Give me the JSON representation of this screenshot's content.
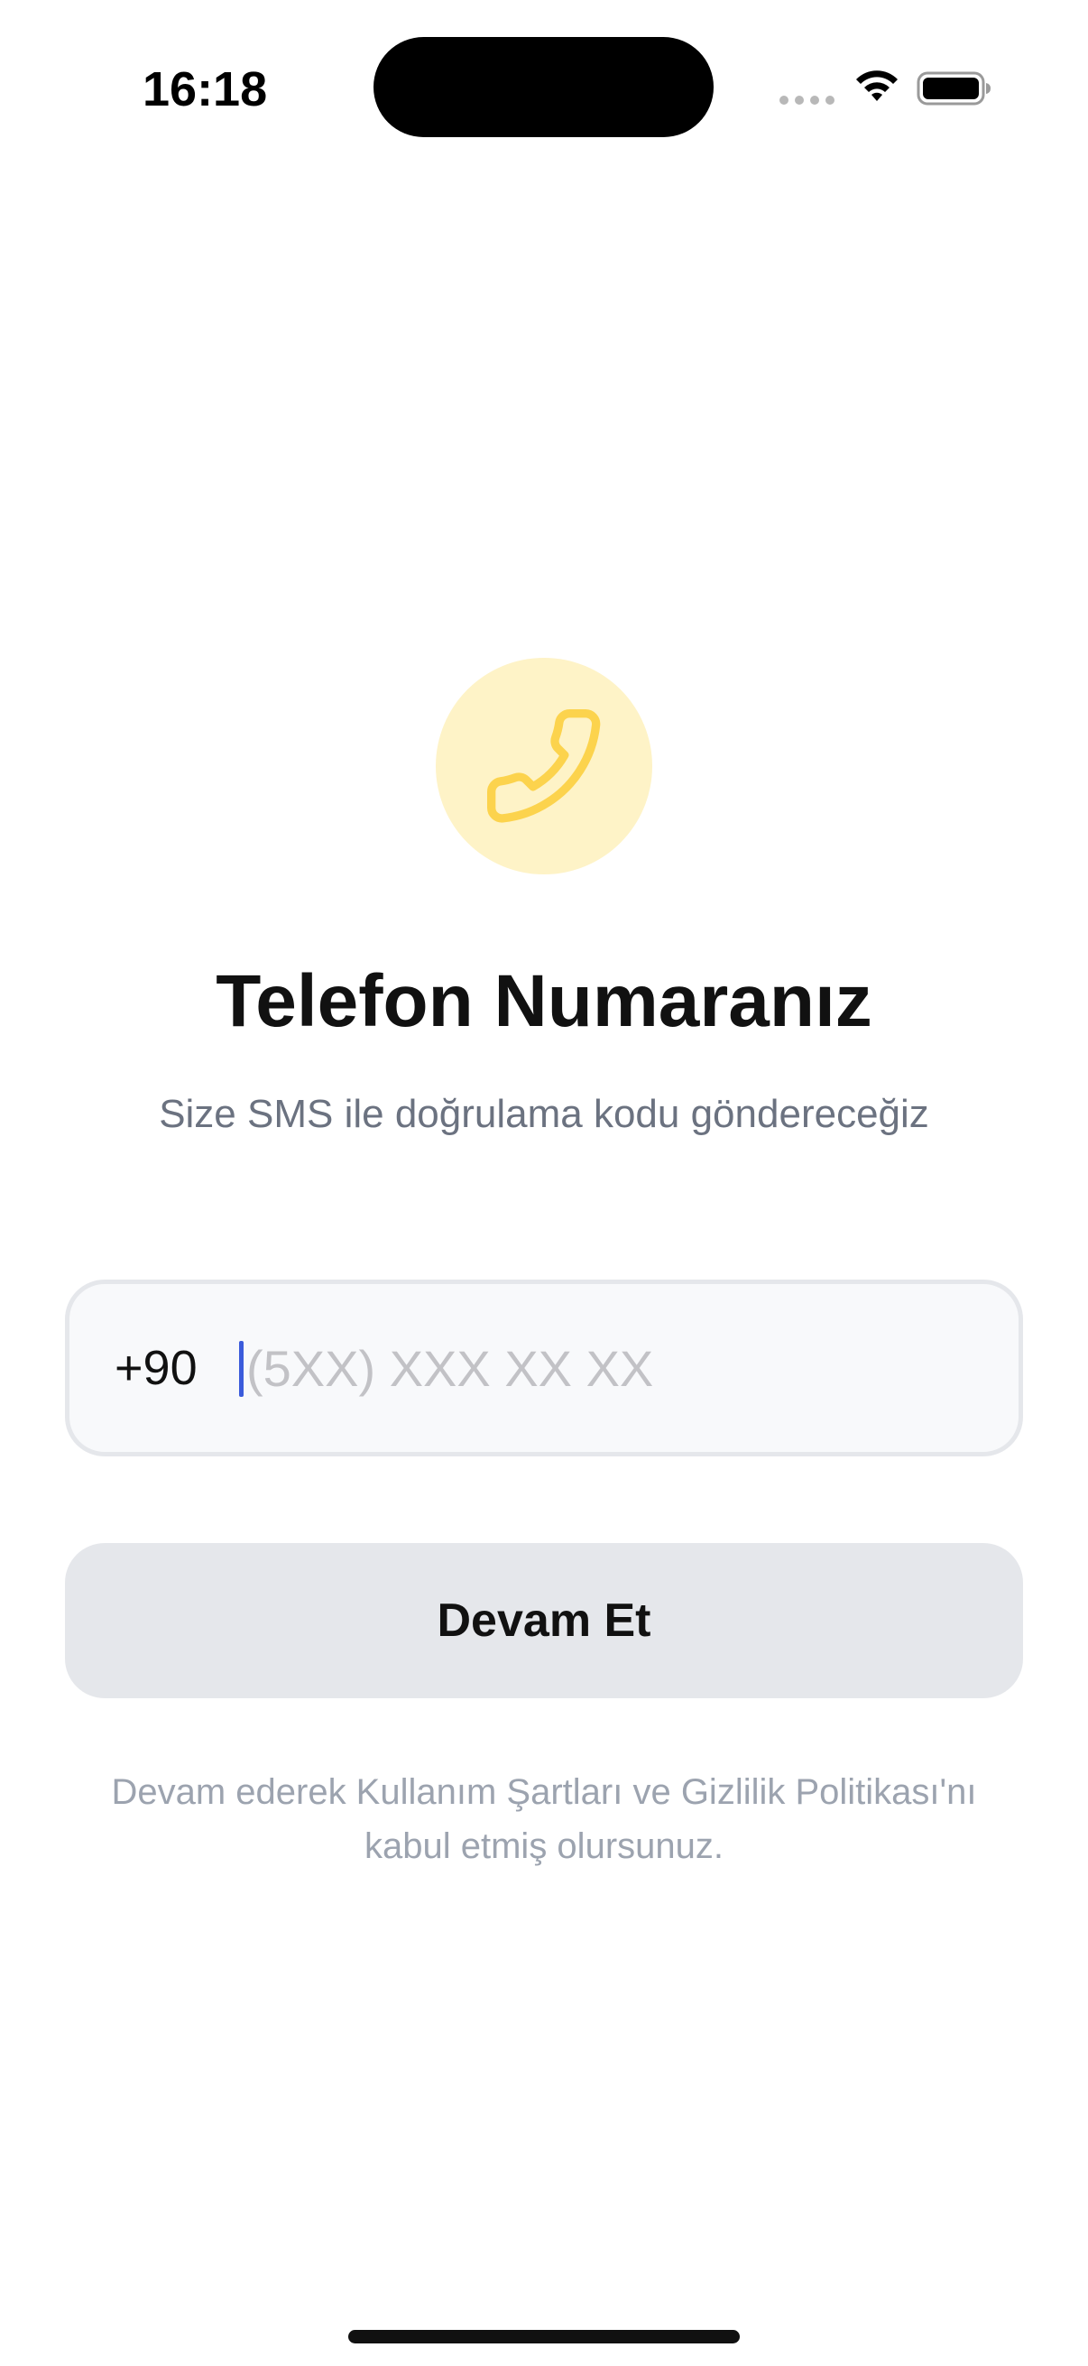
{
  "status_bar": {
    "time": "16:18"
  },
  "icons": {
    "phone": "phone-icon",
    "wifi": "wifi-icon",
    "battery": "battery-icon"
  },
  "colors": {
    "badge_background": "#fef3c7",
    "phone_icon": "#fcd34d",
    "caret": "#3b5bdb",
    "button_background": "#e5e7eb"
  },
  "header": {
    "title": "Telefon Numaranız",
    "subtitle": "Size SMS ile doğrulama kodu göndereceğiz"
  },
  "phone_field": {
    "country_code": "+90",
    "value": "",
    "placeholder": "(5XX) XXX XX XX"
  },
  "actions": {
    "continue_label": "Devam Et"
  },
  "footer": {
    "terms_line1": "Devam ederek Kullanım Şartları ve Gizlilik Politikası'nı",
    "terms_line2": "kabul etmiş olursunuz."
  }
}
